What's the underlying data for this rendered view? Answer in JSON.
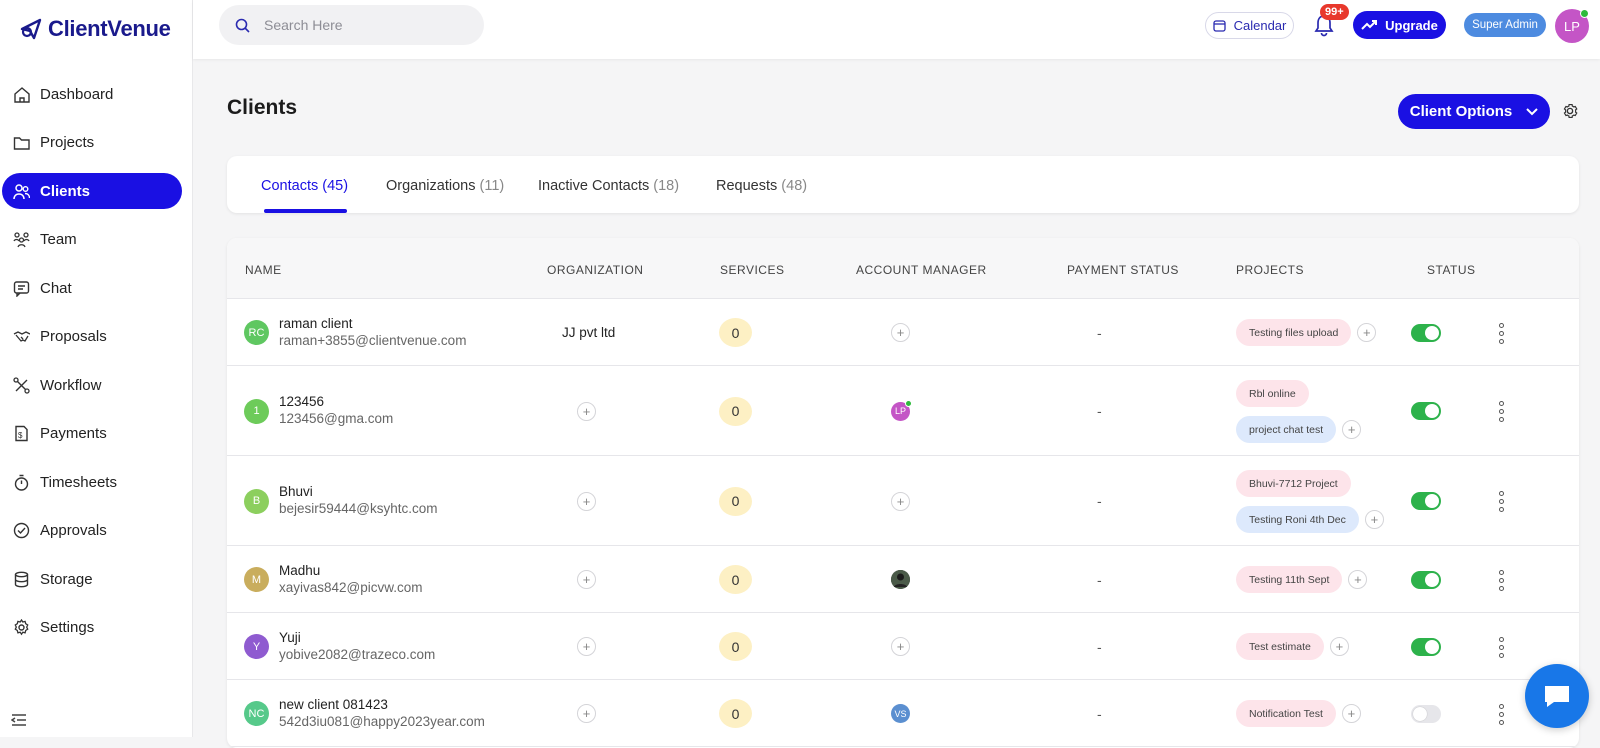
{
  "app": {
    "name": "ClientVenue"
  },
  "sidebar": {
    "items": [
      {
        "label": "Dashboard",
        "icon": "home-icon"
      },
      {
        "label": "Projects",
        "icon": "folder-icon"
      },
      {
        "label": "Clients",
        "icon": "users-icon",
        "active": true
      },
      {
        "label": "Team",
        "icon": "team-icon"
      },
      {
        "label": "Chat",
        "icon": "chat-icon"
      },
      {
        "label": "Proposals",
        "icon": "handshake-icon"
      },
      {
        "label": "Workflow",
        "icon": "workflow-icon"
      },
      {
        "label": "Payments",
        "icon": "payments-icon"
      },
      {
        "label": "Timesheets",
        "icon": "stopwatch-icon"
      },
      {
        "label": "Approvals",
        "icon": "check-circle-icon"
      },
      {
        "label": "Storage",
        "icon": "database-icon"
      },
      {
        "label": "Settings",
        "icon": "gear-icon"
      }
    ]
  },
  "topbar": {
    "search_placeholder": "Search Here",
    "calendar_label": "Calendar",
    "notification_badge": "99+",
    "upgrade_label": "Upgrade",
    "role_label": "Super Admin",
    "avatar_initials": "LP"
  },
  "page": {
    "title": "Clients",
    "client_options_label": "Client Options"
  },
  "tabs": [
    {
      "label": "Contacts",
      "count": "(45)",
      "active": true
    },
    {
      "label": "Organizations",
      "count": "(11)"
    },
    {
      "label": "Inactive Contacts",
      "count": "(18)"
    },
    {
      "label": "Requests",
      "count": "(48)"
    }
  ],
  "table": {
    "headers": [
      "NAME",
      "ORGANIZATION",
      "SERVICES",
      "ACCOUNT MANAGER",
      "PAYMENT STATUS",
      "PROJECTS",
      "STATUS"
    ],
    "rows": [
      {
        "initials": "RC",
        "avatar_color": "#5fc761",
        "name": "raman client",
        "email": "raman+3855@clientvenue.com",
        "organization": "JJ pvt ltd",
        "services": "0",
        "manager": null,
        "payment": "-",
        "projects": [
          {
            "label": "Testing files upload",
            "color": "pink"
          }
        ],
        "active": true
      },
      {
        "initials": "1",
        "avatar_color": "#6dcb5a",
        "name": "123456",
        "email": "123456@gma.com",
        "organization": null,
        "services": "0",
        "manager": {
          "initials": "LP",
          "color": "#c455c6",
          "online": true
        },
        "payment": "-",
        "projects": [
          {
            "label": "Rbl online",
            "color": "pink"
          },
          {
            "label": "project chat test",
            "color": "blue"
          }
        ],
        "active": true
      },
      {
        "initials": "B",
        "avatar_color": "#8ccf5e",
        "name": "Bhuvi",
        "email": "bejesir59444@ksyhtc.com",
        "organization": null,
        "services": "0",
        "manager": null,
        "payment": "-",
        "projects": [
          {
            "label": "Bhuvi-7712 Project",
            "color": "pink"
          },
          {
            "label": "Testing Roni 4th Dec",
            "color": "blue"
          }
        ],
        "active": true
      },
      {
        "initials": "M",
        "avatar_color": "#c9ad5d",
        "name": "Madhu",
        "email": "xayivas842@picvw.com",
        "organization": null,
        "services": "0",
        "manager": {
          "initials": "",
          "color": "#2e3a2e",
          "online": false,
          "photo": true
        },
        "payment": "-",
        "projects": [
          {
            "label": "Testing 11th Sept",
            "color": "pink"
          }
        ],
        "active": true
      },
      {
        "initials": "Y",
        "avatar_color": "#8f5bd0",
        "name": "Yuji",
        "email": "yobive2082@trazeco.com",
        "organization": null,
        "services": "0",
        "manager": null,
        "payment": "-",
        "projects": [
          {
            "label": "Test estimate",
            "color": "pink"
          }
        ],
        "active": true
      },
      {
        "initials": "NC",
        "avatar_color": "#56c98a",
        "name": "new client 081423",
        "email": "542d3iu081@happy2023year.com",
        "organization": null,
        "services": "0",
        "manager": {
          "initials": "VS",
          "color": "#5b8fd0",
          "online": false
        },
        "payment": "-",
        "projects": [
          {
            "label": "Notification Test",
            "color": "pink"
          }
        ],
        "active": false
      }
    ]
  }
}
